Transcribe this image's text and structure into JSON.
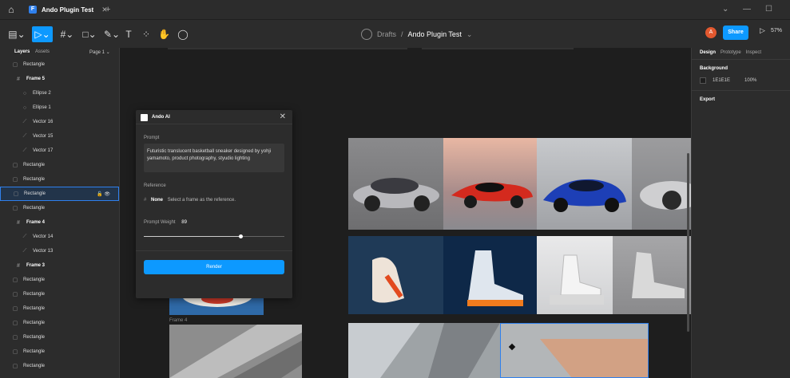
{
  "titlebar": {
    "tab_title": "Ando Plugin Test",
    "tab_close": "✕",
    "new_tab": "+",
    "minimize": "—",
    "maximize": "☐"
  },
  "toolbar": {
    "breadcrumb_project": "Drafts",
    "breadcrumb_sep": "/",
    "breadcrumb_file": "Ando Plugin Test",
    "breadcrumb_chevron": "⌄",
    "avatar_initial": "A",
    "share_label": "Share",
    "zoom_label": "57%"
  },
  "layers_panel": {
    "tab_layers": "Layers",
    "tab_assets": "Assets",
    "page_label": "Page 1",
    "layers": [
      {
        "name": "Rectangle",
        "type": "rect"
      },
      {
        "name": "Frame 5",
        "type": "frame"
      },
      {
        "name": "Ellipse 2",
        "type": "ellipse"
      },
      {
        "name": "Ellipse 1",
        "type": "ellipse"
      },
      {
        "name": "Vector 16",
        "type": "vector"
      },
      {
        "name": "Vector 15",
        "type": "vector"
      },
      {
        "name": "Vector 17",
        "type": "vector"
      },
      {
        "name": "Rectangle",
        "type": "rect"
      },
      {
        "name": "Rectangle",
        "type": "rect"
      },
      {
        "name": "Rectangle",
        "type": "rect",
        "selected": true
      },
      {
        "name": "Rectangle",
        "type": "rect"
      },
      {
        "name": "Frame 4",
        "type": "frame"
      },
      {
        "name": "Vector 14",
        "type": "vector"
      },
      {
        "name": "Vector 13",
        "type": "vector"
      },
      {
        "name": "Frame 3",
        "type": "frame"
      },
      {
        "name": "Rectangle",
        "type": "rect"
      },
      {
        "name": "Rectangle",
        "type": "rect"
      },
      {
        "name": "Rectangle",
        "type": "rect"
      },
      {
        "name": "Rectangle",
        "type": "rect"
      },
      {
        "name": "Rectangle",
        "type": "rect"
      },
      {
        "name": "Rectangle",
        "type": "rect"
      },
      {
        "name": "Rectangle",
        "type": "rect"
      }
    ]
  },
  "design_panel": {
    "tab_design": "Design",
    "tab_prototype": "Prototype",
    "tab_inspect": "Inspect",
    "background_title": "Background",
    "background_hex": "1E1E1E",
    "background_opacity": "100%",
    "export_title": "Export"
  },
  "ando_ai": {
    "title": "Ando AI",
    "close": "✕",
    "prompt_label": "Prompt",
    "prompt_text": "Futuristic translucent basketball sneaker designed by yohji yamamoto, product photography, styudio lighting",
    "reference_label": "Reference",
    "reference_none": "None",
    "reference_hint": "Select a frame as the reference.",
    "weight_label": "Prompt Weight",
    "weight_value": "89",
    "weight_fraction": 0.69,
    "render_label": "Render"
  },
  "canvas": {
    "frame_label": "Frame 4"
  },
  "colors": {
    "accent": "#0d99ff",
    "panel": "#2c2c2c",
    "canvas": "#1e1e1e"
  }
}
